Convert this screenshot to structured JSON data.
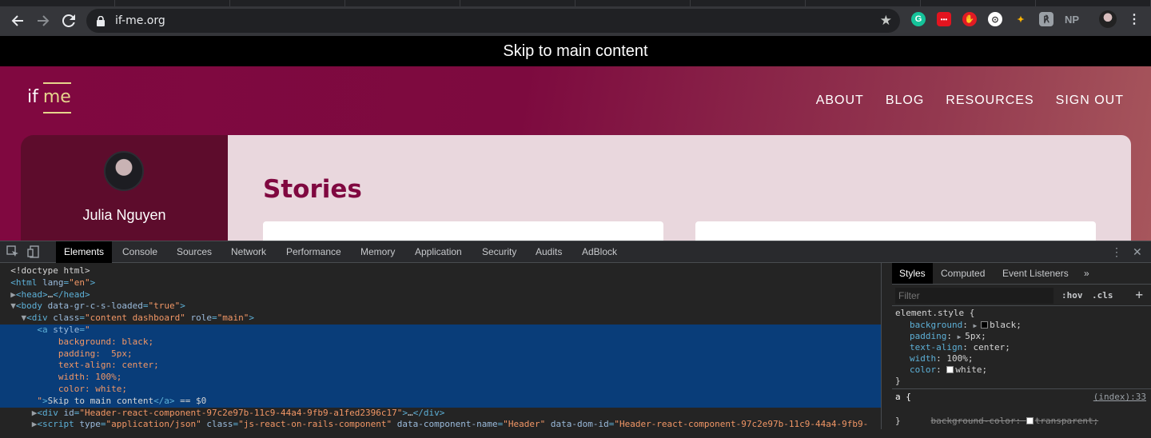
{
  "browser": {
    "url": "if-me.org",
    "extensions": [
      "G",
      "•••",
      "✋",
      "⊙",
      "✦",
      "℟",
      "NP"
    ]
  },
  "page": {
    "skip_link": "Skip to main content",
    "logo_prefix": "if",
    "logo_accent": "me",
    "nav": [
      "ABOUT",
      "BLOG",
      "RESOURCES",
      "SIGN OUT"
    ],
    "user_name": "Julia Nguyen",
    "heading": "Stories",
    "colors": {
      "brand": "#800840",
      "accent": "#e6d58c",
      "sidebar": "#5d0c2c"
    }
  },
  "devtools": {
    "tabs": [
      "Elements",
      "Console",
      "Sources",
      "Network",
      "Performance",
      "Memory",
      "Application",
      "Security",
      "Audits",
      "AdBlock"
    ],
    "active_tab": "Elements",
    "dom_lines": [
      {
        "indent": "  ",
        "tri": "",
        "parts": [
          [
            "cm",
            "<!doctype html>"
          ]
        ]
      },
      {
        "indent": "  ",
        "tri": "",
        "parts": [
          [
            "tg",
            "<html "
          ],
          [
            "at",
            "lang"
          ],
          [
            "tg",
            "="
          ],
          [
            "av",
            "\"en\""
          ],
          [
            "tg",
            ">"
          ]
        ]
      },
      {
        "indent": "  ",
        "tri": "▶",
        "parts": [
          [
            "tg",
            "<head>"
          ],
          [
            "cm",
            "…"
          ],
          [
            "tg",
            "</head>"
          ]
        ]
      },
      {
        "indent": "  ",
        "tri": "▼",
        "parts": [
          [
            "tg",
            "<body "
          ],
          [
            "at",
            "data-gr-c-s-loaded"
          ],
          [
            "tg",
            "="
          ],
          [
            "av",
            "\"true\""
          ],
          [
            "tg",
            ">"
          ]
        ]
      },
      {
        "indent": "    ",
        "tri": "▼",
        "parts": [
          [
            "tg",
            "<div "
          ],
          [
            "at",
            "class"
          ],
          [
            "tg",
            "="
          ],
          [
            "av",
            "\"content dashboard\""
          ],
          [
            "tg",
            " "
          ],
          [
            "at",
            "role"
          ],
          [
            "tg",
            "="
          ],
          [
            "av",
            "\"main\""
          ],
          [
            "tg",
            ">"
          ]
        ]
      },
      {
        "indent": "       ",
        "tri": "",
        "sel": true,
        "parts": [
          [
            "tg",
            "<a "
          ],
          [
            "at",
            "style"
          ],
          [
            "tg",
            "="
          ],
          [
            "av",
            "\""
          ]
        ]
      },
      {
        "indent": "           ",
        "tri": "",
        "sel": true,
        "parts": [
          [
            "av",
            "background: black;"
          ]
        ]
      },
      {
        "indent": "           ",
        "tri": "",
        "sel": true,
        "parts": [
          [
            "av",
            "padding:  5px;"
          ]
        ]
      },
      {
        "indent": "           ",
        "tri": "",
        "sel": true,
        "parts": [
          [
            "av",
            "text-align: center;"
          ]
        ]
      },
      {
        "indent": "           ",
        "tri": "",
        "sel": true,
        "parts": [
          [
            "av",
            "width: 100%;"
          ]
        ]
      },
      {
        "indent": "           ",
        "tri": "",
        "sel": true,
        "parts": [
          [
            "av",
            "color: white;"
          ]
        ]
      },
      {
        "indent": "       ",
        "tri": "",
        "sel": true,
        "parts": [
          [
            "av",
            "\""
          ],
          [
            "tg",
            ">"
          ],
          [
            "cm",
            "Skip to main content"
          ],
          [
            "tg",
            "</a>"
          ],
          [
            "cm",
            " == $0"
          ]
        ]
      },
      {
        "indent": "      ",
        "tri": "▶",
        "parts": [
          [
            "tg",
            "<div "
          ],
          [
            "at",
            "id"
          ],
          [
            "tg",
            "="
          ],
          [
            "av",
            "\"Header-react-component-97c2e97b-11c9-44a4-9fb9-a1fed2396c17\""
          ],
          [
            "tg",
            ">"
          ],
          [
            "cm",
            "…"
          ],
          [
            "tg",
            "</div>"
          ]
        ]
      },
      {
        "indent": "      ",
        "tri": "▶",
        "parts": [
          [
            "tg",
            "<script "
          ],
          [
            "at",
            "type"
          ],
          [
            "tg",
            "="
          ],
          [
            "av",
            "\"application/json\""
          ],
          [
            "tg",
            " "
          ],
          [
            "at",
            "class"
          ],
          [
            "tg",
            "="
          ],
          [
            "av",
            "\"js-react-on-rails-component\""
          ],
          [
            "tg",
            " "
          ],
          [
            "at",
            "data-component-name"
          ],
          [
            "tg",
            "="
          ],
          [
            "av",
            "\"Header\""
          ],
          [
            "tg",
            " "
          ],
          [
            "at",
            "data-dom-id"
          ],
          [
            "tg",
            "="
          ],
          [
            "av",
            "\"Header-react-component-97c2e97b-11c9-44a4-9fb9-"
          ]
        ]
      }
    ],
    "side_tabs": [
      "Styles",
      "Computed",
      "Event Listeners"
    ],
    "filter_placeholder": "Filter",
    "hov": ":hov",
    "cls": ".cls",
    "element_style_selector": "element.style {",
    "element_style": [
      {
        "prop": "background",
        "expand": true,
        "swatch": "#000000",
        "value": "black;"
      },
      {
        "prop": "padding",
        "expand": true,
        "swatch": "",
        "value": "5px;"
      },
      {
        "prop": "text-align",
        "expand": false,
        "swatch": "",
        "value": "center;"
      },
      {
        "prop": "width",
        "expand": false,
        "swatch": "",
        "value": "100%;"
      },
      {
        "prop": "color",
        "expand": false,
        "swatch": "#ffffff",
        "value": "white;"
      }
    ],
    "close_brace": "}",
    "rule2_selector": "a {",
    "rule2_source": "(index):33",
    "rule2_prop": "background-color",
    "rule2_value": "transparent;"
  }
}
